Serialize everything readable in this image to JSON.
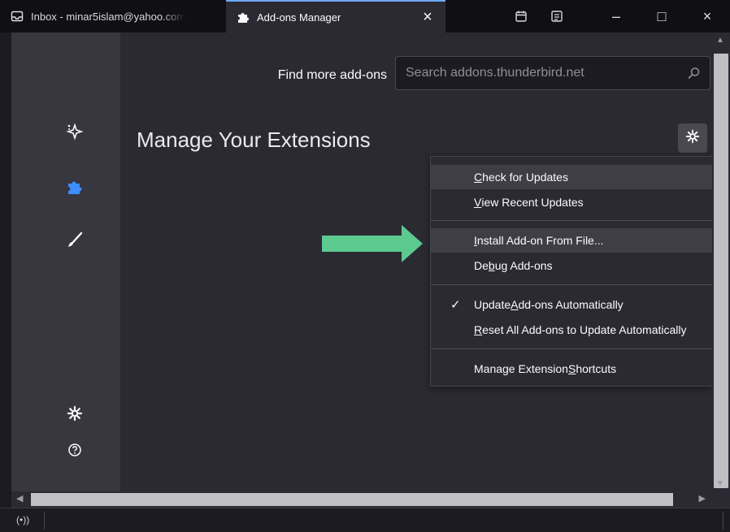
{
  "tabs": [
    {
      "title": "Inbox - minar5islam@yahoo.com",
      "icon": "inbox-icon",
      "active": false
    },
    {
      "title": "Add-ons Manager",
      "icon": "puzzle-icon",
      "active": true,
      "close": "×"
    }
  ],
  "window_controls": {
    "minimize": "–",
    "maximize": "□",
    "close": "×"
  },
  "header": {
    "find_label": "Find more add-ons",
    "search_placeholder": "Search addons.thunderbird.net"
  },
  "main": {
    "title": "Manage Your Extensions"
  },
  "menu": {
    "items": [
      {
        "pre": "",
        "u": "C",
        "post": "heck for Updates",
        "highlighted": true
      },
      {
        "pre": "",
        "u": "V",
        "post": "iew Recent Updates",
        "highlighted": false
      },
      {
        "pre": "",
        "u": "I",
        "post": "nstall Add-on From File...",
        "highlighted": true
      },
      {
        "pre": "De",
        "u": "b",
        "post": "ug Add-ons",
        "highlighted": false
      },
      {
        "pre": "Update ",
        "u": "A",
        "post": "dd-ons Automatically",
        "highlighted": false,
        "checked": true
      },
      {
        "pre": "",
        "u": "R",
        "post": "eset All Add-ons to Update Automatically",
        "highlighted": false
      },
      {
        "pre": "Manage Extension ",
        "u": "S",
        "post": "hortcuts",
        "highlighted": false
      }
    ],
    "check_mark": "✓"
  },
  "sidebar": {
    "items": [
      "recommendations-icon",
      "extensions-icon",
      "themes-icon"
    ],
    "bottom": [
      "settings-icon",
      "help-icon"
    ]
  },
  "colors": {
    "accent": "#3f8dff",
    "arrow": "#5cc98f"
  },
  "status": {
    "icon": "(•))"
  }
}
